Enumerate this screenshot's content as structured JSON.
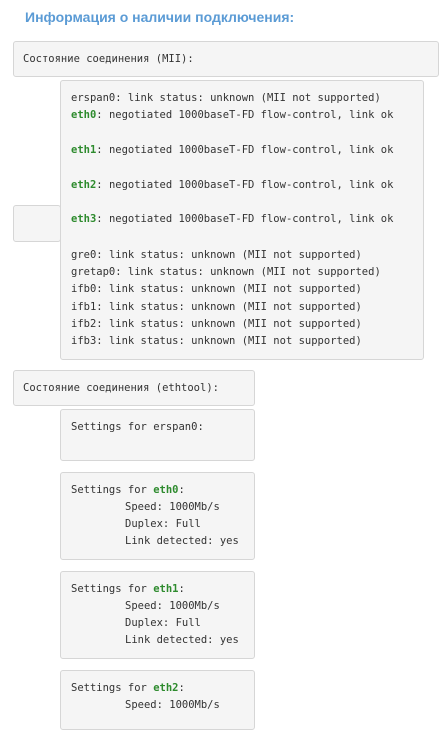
{
  "page_title": "Информация о наличии подключения:",
  "mii_section": {
    "label": "Состояние соединения (MII):",
    "lines": [
      {
        "iface": "erspan0",
        "text": ": link status: unknown (MII not supported)",
        "highlight": false
      },
      {
        "iface": "eth0",
        "text": ": negotiated 1000baseT-FD flow-control, link ok",
        "highlight": true
      },
      {
        "iface": "eth1",
        "text": ": negotiated 1000baseT-FD flow-control, link ok",
        "highlight": true
      },
      {
        "iface": "eth2",
        "text": ": negotiated 1000baseT-FD flow-control, link ok",
        "highlight": true
      },
      {
        "iface": "eth3",
        "text": ": negotiated 1000baseT-FD flow-control, link ok",
        "highlight": true
      },
      {
        "iface": "gre0",
        "text": ": link status: unknown (MII not supported)",
        "highlight": false
      },
      {
        "iface": "gretap0",
        "text": ": link status: unknown (MII not supported)",
        "highlight": false
      },
      {
        "iface": "ifb0",
        "text": ": link status: unknown (MII not supported)",
        "highlight": false
      },
      {
        "iface": "ifb1",
        "text": ": link status: unknown (MII not supported)",
        "highlight": false
      },
      {
        "iface": "ifb2",
        "text": ": link status: unknown (MII not supported)",
        "highlight": false
      },
      {
        "iface": "ifb3",
        "text": ": link status: unknown (MII not supported)",
        "highlight": false
      }
    ]
  },
  "ethtool_section": {
    "label": "Состояние соединения (ethtool):",
    "settings_prefix": "Settings for ",
    "blocks": [
      {
        "iface": "erspan0",
        "highlight": false,
        "details": []
      },
      {
        "iface": "eth0",
        "highlight": true,
        "details": [
          "Speed: 1000Mb/s",
          "Duplex: Full",
          "Link detected: yes"
        ]
      },
      {
        "iface": "eth1",
        "highlight": true,
        "details": [
          "Speed: 1000Mb/s",
          "Duplex: Full",
          "Link detected: yes"
        ]
      },
      {
        "iface": "eth2",
        "highlight": true,
        "details": [
          "Speed: 1000Mb/s"
        ]
      }
    ]
  },
  "colors": {
    "title": "#5b9bd5",
    "iface_highlight": "#2e8b2e",
    "box_bg": "#f5f5f5",
    "box_border": "#d6d6d6"
  }
}
